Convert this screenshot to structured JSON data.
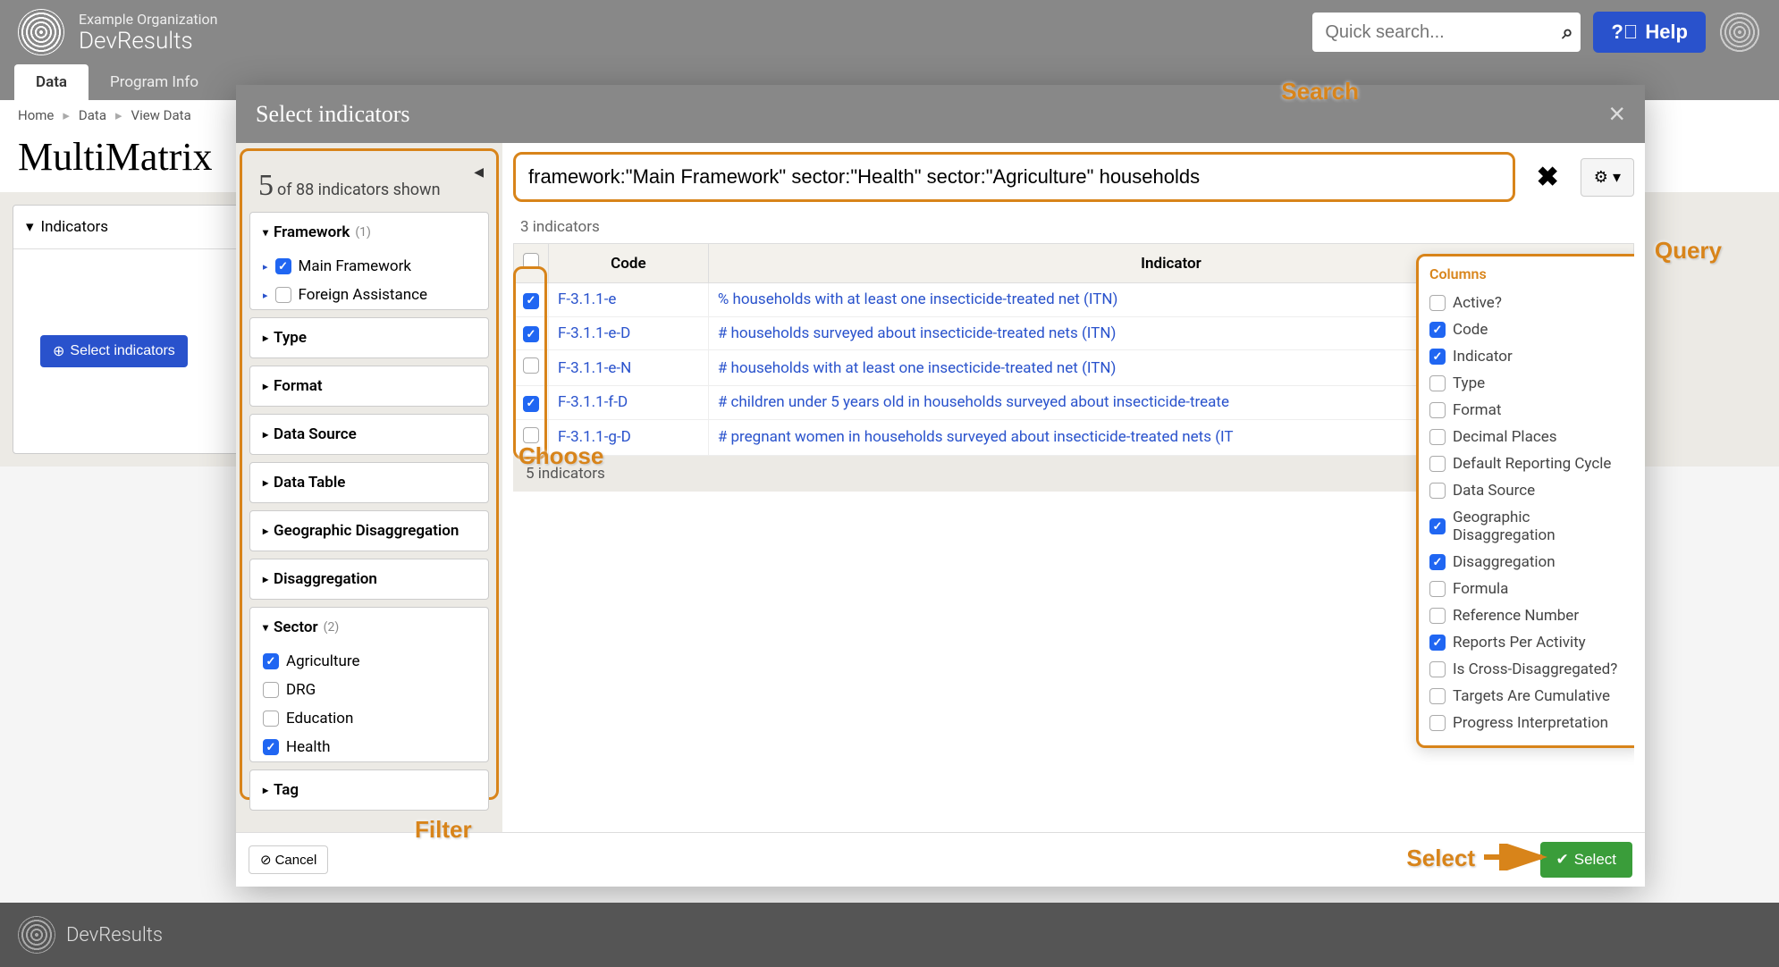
{
  "header": {
    "org": "Example Organization",
    "app": "DevResults",
    "searchPlaceholder": "Quick search...",
    "helpLabel": "Help"
  },
  "tabs": {
    "active": "Data",
    "other": "Program Info"
  },
  "breadcrumbs": [
    "Home",
    "Data",
    "View Data"
  ],
  "pageTitle": "MultiMatrix",
  "bgPanel": {
    "indicatorsHeader": "Indicators",
    "selectIndicatorsBtn": "Select indicators"
  },
  "modal": {
    "title": "Select indicators",
    "count": {
      "shown": "5",
      "totalText": "of 88 indicators shown"
    },
    "filters": [
      {
        "label": "Framework",
        "count": "(1)",
        "expanded": true,
        "items": [
          {
            "label": "Main Framework",
            "checked": true,
            "hasChildren": true
          },
          {
            "label": "Foreign Assistance",
            "checked": false,
            "hasChildren": true
          }
        ]
      },
      {
        "label": "Type",
        "expanded": false
      },
      {
        "label": "Format",
        "expanded": false
      },
      {
        "label": "Data Source",
        "expanded": false
      },
      {
        "label": "Data Table",
        "expanded": false
      },
      {
        "label": "Geographic Disaggregation",
        "expanded": false
      },
      {
        "label": "Disaggregation",
        "expanded": false
      },
      {
        "label": "Sector",
        "count": "(2)",
        "expanded": true,
        "items": [
          {
            "label": "Agriculture",
            "checked": true
          },
          {
            "label": "DRG",
            "checked": false
          },
          {
            "label": "Education",
            "checked": false
          },
          {
            "label": "Health",
            "checked": true
          }
        ]
      },
      {
        "label": "Tag",
        "expanded": false
      }
    ],
    "searchQuery": "framework:\"Main Framework\" sector:\"Health\" sector:\"Agriculture\" households",
    "selectedCountLabel": "3 indicators",
    "tableHeaders": {
      "code": "Code",
      "indicator": "Indicator"
    },
    "rows": [
      {
        "checked": true,
        "code": "F-3.1.1-e",
        "indicator": "% households with at least one insecticide-treated net (ITN)"
      },
      {
        "checked": true,
        "code": "F-3.1.1-e-D",
        "indicator": "# households surveyed about insecticide-treated nets (ITN)"
      },
      {
        "checked": false,
        "code": "F-3.1.1-e-N",
        "indicator": "# households with at least one insecticide-treated net (ITN)"
      },
      {
        "checked": true,
        "code": "F-3.1.1-f-D",
        "indicator": "# children under 5 years old in households surveyed about insecticide-treate"
      },
      {
        "checked": false,
        "code": "F-3.1.1-g-D",
        "indicator": "# pregnant women in households surveyed about insecticide-treated nets (IT"
      }
    ],
    "rowCountFooter": "5 indicators",
    "columnsTitle": "Columns",
    "columns": [
      {
        "label": "Active?",
        "checked": false
      },
      {
        "label": "Code",
        "checked": true
      },
      {
        "label": "Indicator",
        "checked": true
      },
      {
        "label": "Type",
        "checked": false
      },
      {
        "label": "Format",
        "checked": false
      },
      {
        "label": "Decimal Places",
        "checked": false
      },
      {
        "label": "Default Reporting Cycle",
        "checked": false
      },
      {
        "label": "Data Source",
        "checked": false
      },
      {
        "label": "Geographic Disaggregation",
        "checked": true
      },
      {
        "label": "Disaggregation",
        "checked": true
      },
      {
        "label": "Formula",
        "checked": false
      },
      {
        "label": "Reference Number",
        "checked": false
      },
      {
        "label": "Reports Per Activity",
        "checked": true
      },
      {
        "label": "Is Cross-Disaggregated?",
        "checked": false
      },
      {
        "label": "Targets Are Cumulative",
        "checked": false
      },
      {
        "label": "Progress Interpretation",
        "checked": false
      }
    ],
    "cancelLabel": "Cancel",
    "selectLabel": "Select"
  },
  "annotations": {
    "search": "Search",
    "query": "Query",
    "choose": "Choose",
    "filter": "Filter",
    "select": "Select"
  },
  "footer": {
    "name": "DevResults"
  }
}
